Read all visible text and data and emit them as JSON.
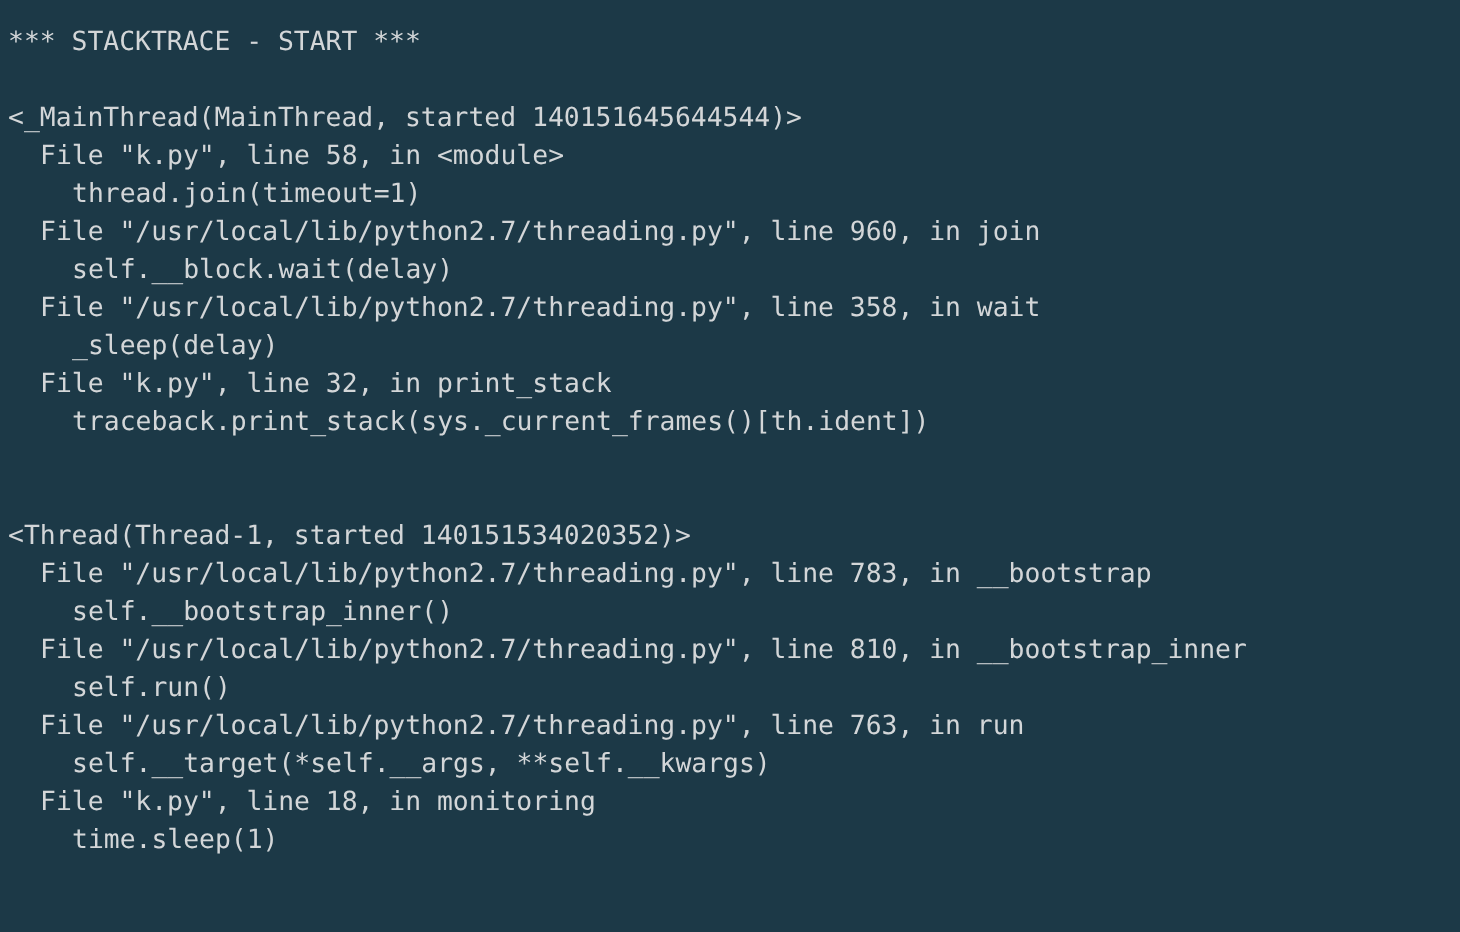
{
  "terminal": {
    "title": "*** STACKTRACE - START ***",
    "threads": [
      {
        "header": "<_MainThread(MainThread, started 140151645644544)>",
        "frames": [
          {
            "file": "File \"k.py\", line 58, in <module>",
            "code": "thread.join(timeout=1)"
          },
          {
            "file": "File \"/usr/local/lib/python2.7/threading.py\", line 960, in join",
            "code": "self.__block.wait(delay)"
          },
          {
            "file": "File \"/usr/local/lib/python2.7/threading.py\", line 358, in wait",
            "code": "_sleep(delay)"
          },
          {
            "file": "File \"k.py\", line 32, in print_stack",
            "code": "traceback.print_stack(sys._current_frames()[th.ident])"
          }
        ]
      },
      {
        "header": "<Thread(Thread-1, started 140151534020352)>",
        "frames": [
          {
            "file": "File \"/usr/local/lib/python2.7/threading.py\", line 783, in __bootstrap",
            "code": "self.__bootstrap_inner()"
          },
          {
            "file": "File \"/usr/local/lib/python2.7/threading.py\", line 810, in __bootstrap_inner",
            "code": "self.run()"
          },
          {
            "file": "File \"/usr/local/lib/python2.7/threading.py\", line 763, in run",
            "code": "self.__target(*self.__args, **self.__kwargs)"
          },
          {
            "file": "File \"k.py\", line 18, in monitoring",
            "code": "time.sleep(1)"
          }
        ]
      }
    ]
  }
}
